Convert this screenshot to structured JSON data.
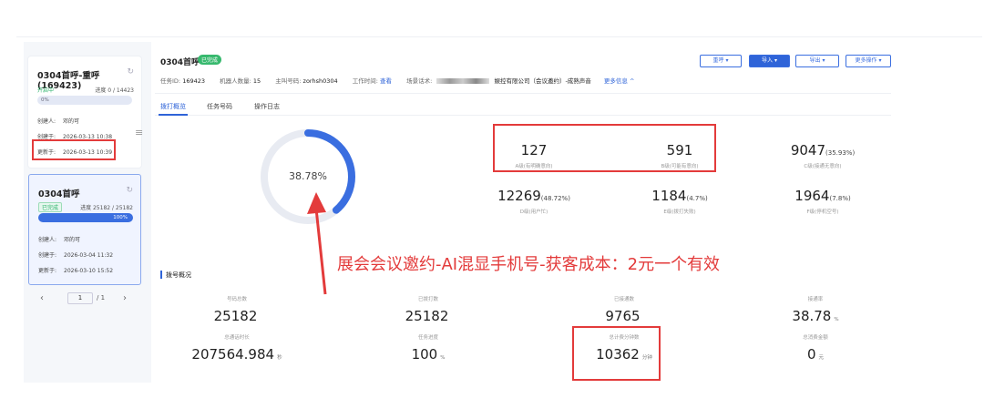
{
  "sidebar": {
    "card1": {
      "title": "0304首呼-重呼(169423)",
      "status": "开启中",
      "progress": "进度 0 / 14423",
      "bar_label": "0%",
      "bar_fill": 0,
      "creator_label": "创建人:",
      "creator": "邓的可",
      "created_label": "创建于:",
      "created": "2026-03-13 10:38",
      "updated_label": "更新于:",
      "updated": "2026-03-13 10:39"
    },
    "card2": {
      "title": "0304首呼",
      "status": "已完成",
      "progress": "进度 25182 / 25182",
      "bar_label": "100%",
      "bar_fill": 1,
      "creator_label": "创建人:",
      "creator": "邓的可",
      "created_label": "创建于:",
      "created": "2026-03-04 11:32",
      "updated_label": "更新于:",
      "updated": "2026-03-10 15:52"
    },
    "pager": {
      "prev": "‹",
      "page": "1",
      "total": "/ 1",
      "next": "›"
    }
  },
  "header": {
    "title": "0304首呼",
    "status_badge": "已完成",
    "task_id_label": "任务ID:",
    "task_id": "169423",
    "robots_label": "机器人数量:",
    "robots": "15",
    "caller_label": "主叫号码:",
    "caller": "zorhsh0304",
    "worktime_label": "工作时间:",
    "worktime_link": "查看",
    "scene_label": "场景话术:",
    "scene_value": "娱控有限公司（会议邀约）-成熟声音",
    "more_info": "更多信息 ^",
    "buttons": {
      "redial": "重呼 ▾",
      "import": "导入 ▾",
      "export": "导出 ▾",
      "more": "更多操作 ▾"
    }
  },
  "tabs": [
    "拨打概览",
    "任务号码",
    "操作日志"
  ],
  "donut": {
    "value_text": "38.78%",
    "fraction": 0.3878
  },
  "intent_stats": [
    {
      "value": "127",
      "pct": "",
      "label": "A级(有明确意向)"
    },
    {
      "value": "591",
      "pct": "",
      "label": "B级(可能有意向)"
    },
    {
      "value": "9047",
      "pct": "(35.93%)",
      "label": "C级(接通无意向)"
    },
    {
      "value": "12269",
      "pct": "(48.72%)",
      "label": "D级(用户忙)"
    },
    {
      "value": "1184",
      "pct": "(4.7%)",
      "label": "E级(拨打失败)"
    },
    {
      "value": "1964",
      "pct": "(7.8%)",
      "label": "F级(停机空号)"
    }
  ],
  "annotation": "展会会议邀约-AI混显手机号-获客成本：2元一个有效",
  "overview": {
    "title": "拨号概况",
    "items": [
      {
        "label": "号码总数",
        "value": "25182",
        "unit": ""
      },
      {
        "label": "已拨打数",
        "value": "25182",
        "unit": ""
      },
      {
        "label": "已接通数",
        "value": "9765",
        "unit": ""
      },
      {
        "label": "接通率",
        "value": "38.78",
        "unit": "%"
      },
      {
        "label": "总通话时长",
        "value": "207564.984",
        "unit": "秒"
      },
      {
        "label": "任务进度",
        "value": "100",
        "unit": "%"
      },
      {
        "label": "总计费分钟数",
        "value": "10362",
        "unit": "分钟"
      },
      {
        "label": "总消费金额",
        "value": "0",
        "unit": "元"
      }
    ]
  },
  "colors": {
    "accent": "#2f64d8",
    "success": "#2db36c",
    "highlight": "#e33b3b",
    "donut_track": "#e8ebf2"
  }
}
